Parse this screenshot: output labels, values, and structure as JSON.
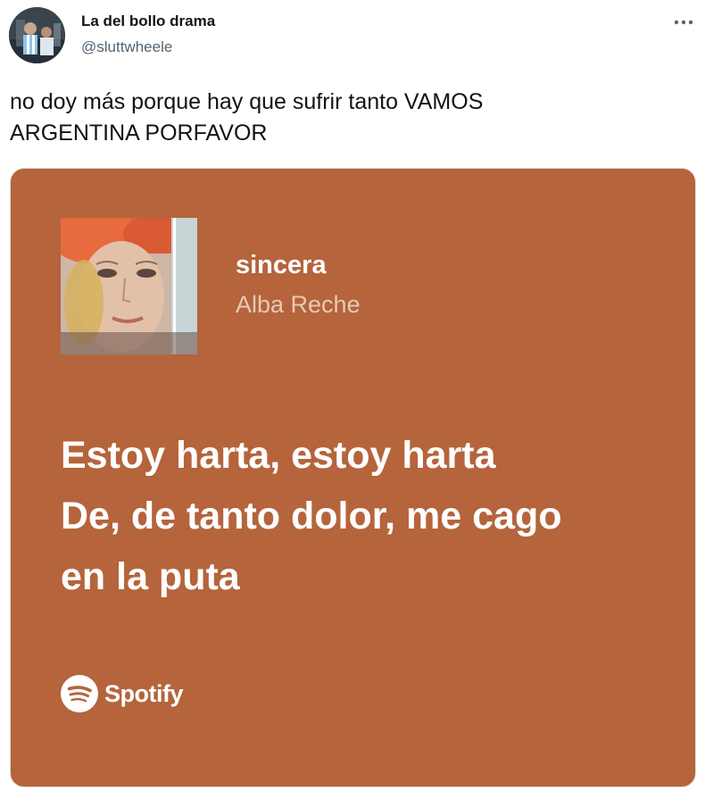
{
  "tweet": {
    "author": {
      "display_name": "La del bollo drama",
      "handle": "@sluttwheele",
      "avatar_icon": "user-avatar"
    },
    "more_icon": "more-icon",
    "text_line_1": "no doy más porque hay que sufrir tanto VAMOS",
    "text_line_2": "ARGENTINA PORFAVOR"
  },
  "spotify_card": {
    "background_color": "#b5643c",
    "song_title": "sincera",
    "artist": "Alba Reche",
    "album_art_icon": "album-cover",
    "lyrics": [
      "Estoy harta, estoy harta",
      "De, de tanto dolor, me cago",
      "en la puta"
    ],
    "brand": "Spotify",
    "brand_icon": "spotify-icon"
  }
}
